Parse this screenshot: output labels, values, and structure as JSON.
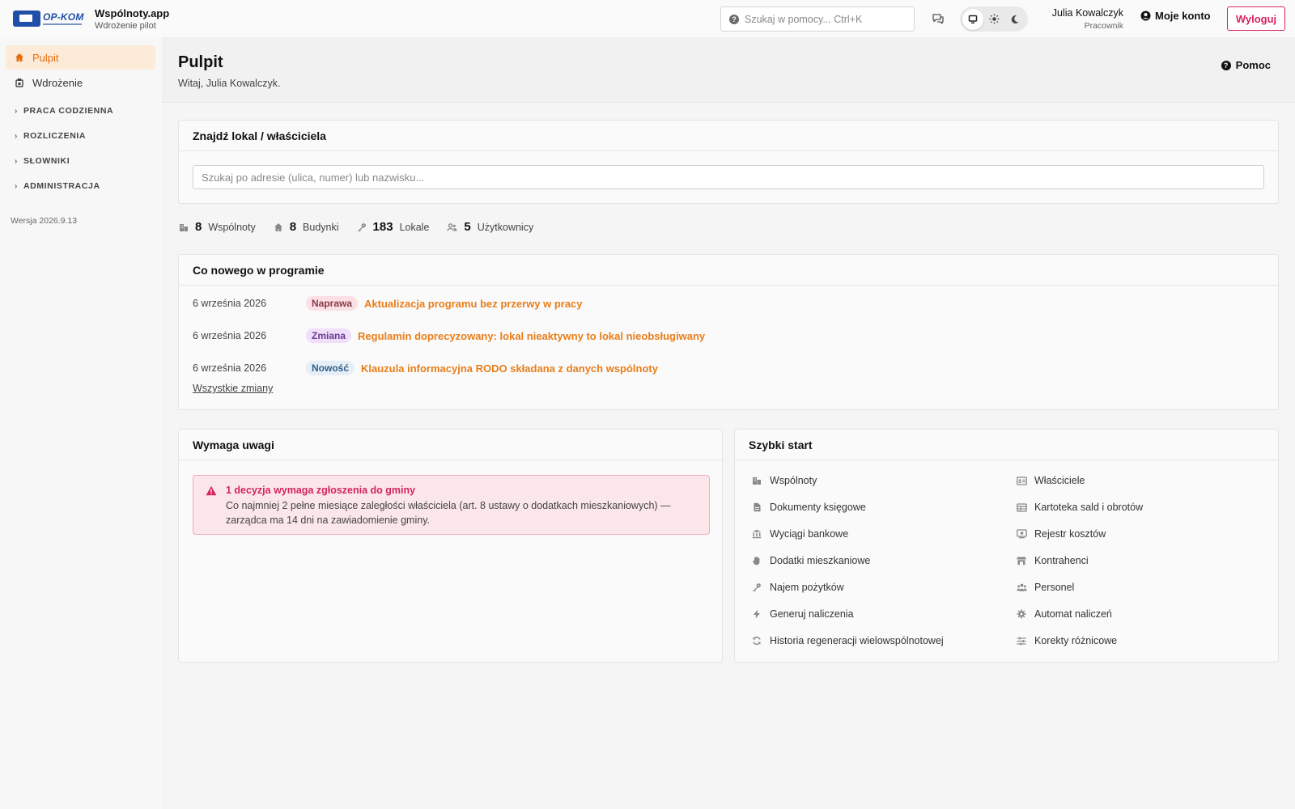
{
  "app": {
    "logo_text": "OP-KOM",
    "name": "Wspólnoty.app",
    "subtitle": "Wdrożenie pilot"
  },
  "header": {
    "help_search_placeholder": "Szukaj w pomocy... Ctrl+K",
    "user_name": "Julia Kowalczyk",
    "user_role": "Pracownik",
    "account_label": "Moje konto",
    "logout_label": "Wyloguj",
    "theme_options": [
      "monitor-icon",
      "sun-icon",
      "moon-icon"
    ],
    "theme_active": "monitor-icon"
  },
  "sidebar": {
    "items": [
      {
        "label": "Pulpit",
        "icon": "home-icon",
        "active": true
      },
      {
        "label": "Wdrożenie",
        "icon": "rocket-icon",
        "active": false
      }
    ],
    "groups": [
      "PRACA CODZIENNA",
      "ROZLICZENIA",
      "SŁOWNIKI",
      "ADMINISTRACJA"
    ],
    "version": "Wersja 2026.9.13"
  },
  "page": {
    "title": "Pulpit",
    "subtitle": "Witaj, Julia Kowalczyk.",
    "help_label": "Pomoc"
  },
  "find": {
    "title": "Znajdź lokal / właściciela",
    "placeholder": "Szukaj po adresie (ulica, numer) lub nazwisku..."
  },
  "stats": [
    {
      "value": "8",
      "label": "Wspólnoty",
      "icon": "buildings-icon"
    },
    {
      "value": "8",
      "label": "Budynki",
      "icon": "house-icon"
    },
    {
      "value": "183",
      "label": "Lokale",
      "icon": "key-icon"
    },
    {
      "value": "5",
      "label": "Użytkownicy",
      "icon": "users-icon"
    }
  ],
  "news": {
    "title": "Co nowego w programie",
    "items": [
      {
        "date": "6 września 2026",
        "badge": "Naprawa",
        "text": "Aktualizacja programu bez przerwy w pracy"
      },
      {
        "date": "6 września 2026",
        "badge": "Zmiana",
        "text": "Regulamin doprecyzowany: lokal nieaktywny to lokal nieobsługiwany"
      },
      {
        "date": "6 września 2026",
        "badge": "Nowość",
        "text": "Klauzula informacyjna RODO składana z danych wspólnoty"
      }
    ],
    "all_label": "Wszystkie zmiany"
  },
  "attention": {
    "title": "Wymaga uwagi",
    "alert_title": "1 decyzja wymaga zgłoszenia do gminy",
    "alert_text": "Co najmniej 2 pełne miesiące zaległości właściciela (art. 8 ustawy o dodatkach mieszkaniowych) — zarządca ma 14 dni na zawiadomienie gminy."
  },
  "quickstart": {
    "title": "Szybki start",
    "left": [
      {
        "label": "Wspólnoty",
        "icon": "buildings-icon"
      },
      {
        "label": "Dokumenty księgowe",
        "icon": "document-icon"
      },
      {
        "label": "Wyciągi bankowe",
        "icon": "bank-icon"
      },
      {
        "label": "Dodatki mieszkaniowe",
        "icon": "hand-icon"
      },
      {
        "label": "Najem pożytków",
        "icon": "key-icon"
      },
      {
        "label": "Generuj naliczenia",
        "icon": "bolt-icon"
      },
      {
        "label": "Historia regeneracji wielowspólnotowej",
        "icon": "refresh-icon"
      }
    ],
    "right": [
      {
        "label": "Właściciele",
        "icon": "id-card-icon"
      },
      {
        "label": "Kartoteka sald i obrotów",
        "icon": "ledger-icon"
      },
      {
        "label": "Rejestr kosztów",
        "icon": "cost-register-icon"
      },
      {
        "label": "Kontrahenci",
        "icon": "store-icon"
      },
      {
        "label": "Personel",
        "icon": "people-icon"
      },
      {
        "label": "Automat naliczeń",
        "icon": "gear-icon"
      },
      {
        "label": "Korekty różnicowe",
        "icon": "sliders-icon"
      }
    ]
  }
}
